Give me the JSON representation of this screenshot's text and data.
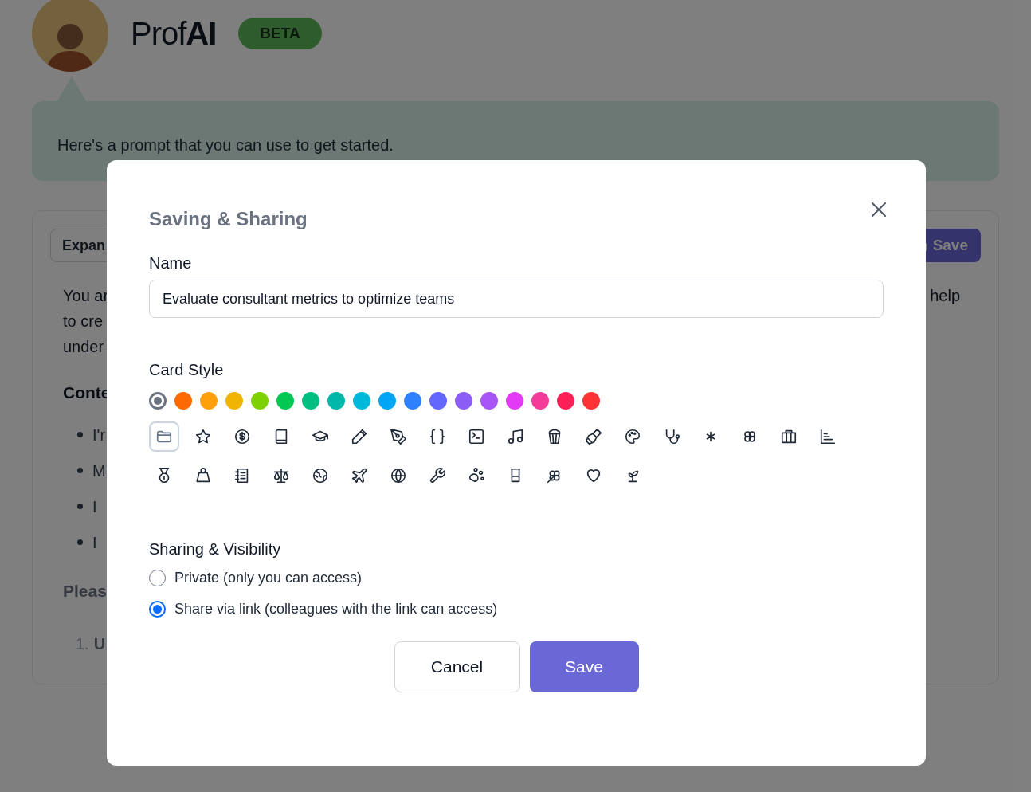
{
  "background": {
    "logo": "Prof**AI**",
    "badge": "BETA",
    "bubble_text": "Here's a prompt that you can use to get started.",
    "card": {
      "expand_button": "Expan",
      "save_button": "Save",
      "paragraph_left": [
        "You ar",
        "to cre",
        "under"
      ],
      "paragraph_right": [
        "help"
      ],
      "heading": "Conte",
      "bullets": [
        "I'r",
        "M",
        "I",
        "I"
      ],
      "note": "Pleas",
      "numbered": [
        {
          "number": "1.",
          "text": "U"
        }
      ]
    }
  },
  "dialog": {
    "title": "Saving & Sharing",
    "name_label": "Name",
    "name_value": "Evaluate consultant metrics to optimize teams",
    "card_style_label": "Card Style",
    "colors": [
      {
        "kind": "none",
        "selected": true
      },
      {
        "kind": "color",
        "color": "#ff6a00",
        "selected": false
      },
      {
        "kind": "color",
        "color": "#ff9f0a",
        "selected": false
      },
      {
        "kind": "color",
        "color": "#f0b400",
        "selected": false
      },
      {
        "kind": "color",
        "color": "#7ed000",
        "selected": false
      },
      {
        "kind": "color",
        "color": "#00c853",
        "selected": false
      },
      {
        "kind": "color",
        "color": "#00bf80",
        "selected": false
      },
      {
        "kind": "color",
        "color": "#00b8a9",
        "selected": false
      },
      {
        "kind": "color",
        "color": "#00b8d9",
        "selected": false
      },
      {
        "kind": "color",
        "color": "#00a6f5",
        "selected": false
      },
      {
        "kind": "color",
        "color": "#2f80ff",
        "selected": false
      },
      {
        "kind": "color",
        "color": "#6366ff",
        "selected": false
      },
      {
        "kind": "color",
        "color": "#8b5cf6",
        "selected": false
      },
      {
        "kind": "color",
        "color": "#a855f7",
        "selected": false
      },
      {
        "kind": "color",
        "color": "#e23af5",
        "selected": false
      },
      {
        "kind": "color",
        "color": "#f53b9a",
        "selected": false
      },
      {
        "kind": "color",
        "color": "#ff1f57",
        "selected": false
      },
      {
        "kind": "color",
        "color": "#ff3333",
        "selected": false
      }
    ],
    "icons": [
      {
        "kind": "folder",
        "selected": true
      },
      {
        "kind": "star",
        "selected": false
      },
      {
        "kind": "dollar",
        "selected": false
      },
      {
        "kind": "book",
        "selected": false
      },
      {
        "kind": "cap",
        "selected": false
      },
      {
        "kind": "pencil",
        "selected": false
      },
      {
        "kind": "pen",
        "selected": false
      },
      {
        "kind": "braces",
        "selected": false
      },
      {
        "kind": "terminal",
        "selected": false
      },
      {
        "kind": "music",
        "selected": false
      },
      {
        "kind": "popcorn",
        "selected": false
      },
      {
        "kind": "brush",
        "selected": false
      },
      {
        "kind": "palette",
        "selected": false
      },
      {
        "kind": "stethoscope",
        "selected": false
      },
      {
        "kind": "asterisk",
        "selected": false
      },
      {
        "kind": "flower",
        "selected": false
      },
      {
        "kind": "briefcase",
        "selected": false
      },
      {
        "kind": "chart",
        "selected": false
      },
      {
        "kind": "medal",
        "selected": false
      },
      {
        "kind": "weight",
        "selected": false
      },
      {
        "kind": "notebook",
        "selected": false
      },
      {
        "kind": "scale",
        "selected": false
      },
      {
        "kind": "earth",
        "selected": false
      },
      {
        "kind": "plane",
        "selected": false
      },
      {
        "kind": "globe",
        "selected": false
      },
      {
        "kind": "wrench",
        "selected": false
      },
      {
        "kind": "paw",
        "selected": false
      },
      {
        "kind": "beaker",
        "selected": false
      },
      {
        "kind": "clover",
        "selected": false
      },
      {
        "kind": "heart",
        "selected": false
      },
      {
        "kind": "sprout",
        "selected": false
      }
    ],
    "sharing_label": "Sharing & Visibility",
    "sharing_options": [
      {
        "label": "Private (only you can access)",
        "selected": false
      },
      {
        "label": "Share via link (colleagues with the link can access)",
        "selected": true
      }
    ],
    "buttons": [
      {
        "kind": "secondary",
        "label": "Cancel"
      },
      {
        "kind": "primary",
        "label": "Save"
      }
    ]
  }
}
